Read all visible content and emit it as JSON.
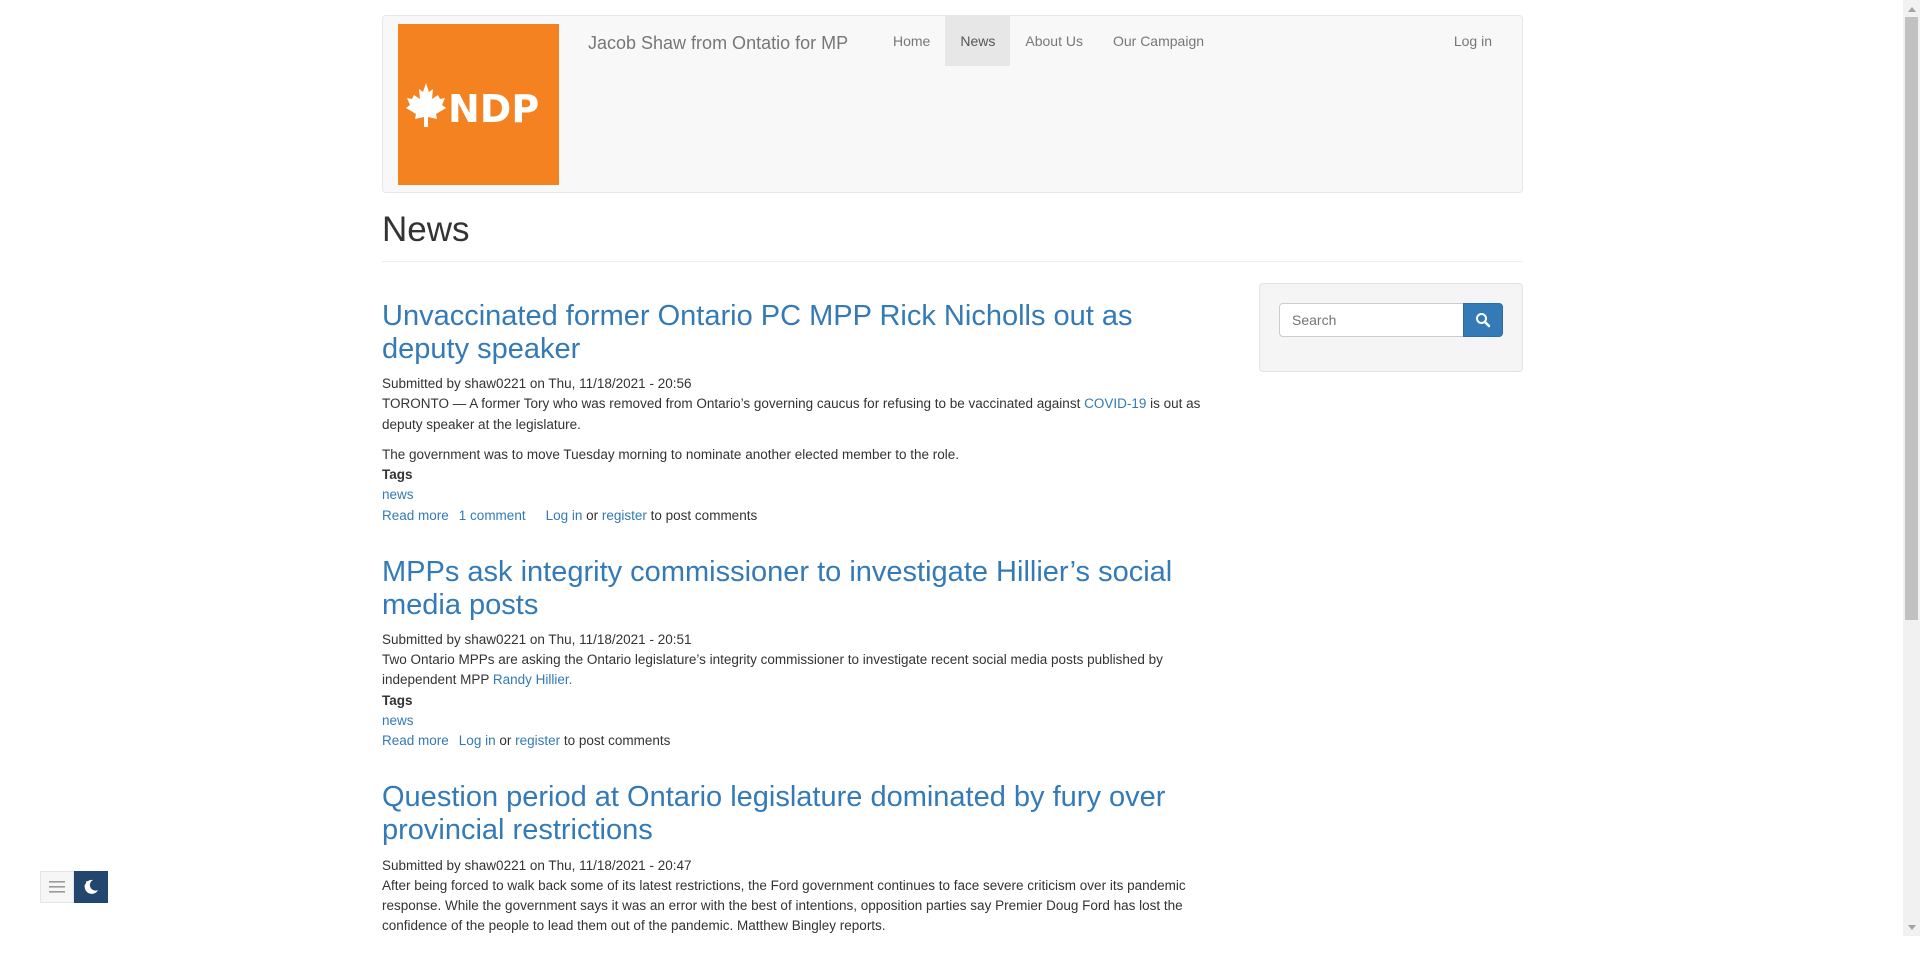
{
  "header": {
    "logo_text": "NDP",
    "site_name": "Jacob Shaw from Ontatio for MP",
    "nav": [
      {
        "label": "Home"
      },
      {
        "label": "News"
      },
      {
        "label": "About Us"
      },
      {
        "label": "Our Campaign"
      }
    ],
    "login_label": "Log in"
  },
  "page": {
    "title": "News"
  },
  "articles": [
    {
      "title": "Unvaccinated former Ontario PC MPP Rick Nicholls out as deputy speaker",
      "submitted": "Submitted by shaw0221 on Thu, 11/18/2021 - 20:56",
      "body1_a": "TORONTO — A former Tory who was removed from Ontario’s governing caucus for refusing to be vaccinated against ",
      "body1_link": "COVID-19",
      "body1_b": " is out as deputy speaker at the legislature.",
      "body2": "The government was to move Tuesday morning to nominate another elected member to the role.",
      "tags_label": "Tags",
      "tag": "news",
      "read_more": "Read more",
      "comments": "1 comment",
      "login": "Log in",
      "or": " or ",
      "register": "register",
      "post_comments": " to post comments"
    },
    {
      "title": "MPPs ask integrity commissioner to investigate Hillier’s social media posts",
      "submitted": "Submitted by shaw0221 on Thu, 11/18/2021 - 20:51",
      "body1_a": "Two Ontario MPPs are asking the Ontario legislature’s integrity commissioner to investigate recent social media posts published by independent MPP ",
      "body1_link": "Randy Hillier.",
      "tags_label": "Tags",
      "tag": "news",
      "read_more": "Read more",
      "login": "Log in",
      "or": " or ",
      "register": "register",
      "post_comments": " to post comments"
    },
    {
      "title": "Question period at Ontario legislature dominated by fury over provincial restrictions",
      "submitted": "Submitted by shaw0221 on Thu, 11/18/2021 - 20:47",
      "body1_a": "After being forced to walk back some of its latest restrictions, the Ford government continues to face severe criticism over its pandemic response. While the government says it was an error with the best of intentions, opposition parties say Premier Doug Ford has lost the confidence of the people to lead them out of the pandemic. Matthew Bingley reports."
    }
  ],
  "sidebar": {
    "search_placeholder": "Search",
    "search_icon": "search-icon"
  },
  "widget": {
    "menu_icon": "hamburger-icon",
    "dark_mode_icon": "moon-icon"
  },
  "colors": {
    "link": "#337ab7",
    "logo_bg": "#f58220",
    "navbar_bg": "#f8f8f8",
    "active_nav_bg": "#e7e7e7",
    "dark_mode_bg": "#23466e"
  }
}
